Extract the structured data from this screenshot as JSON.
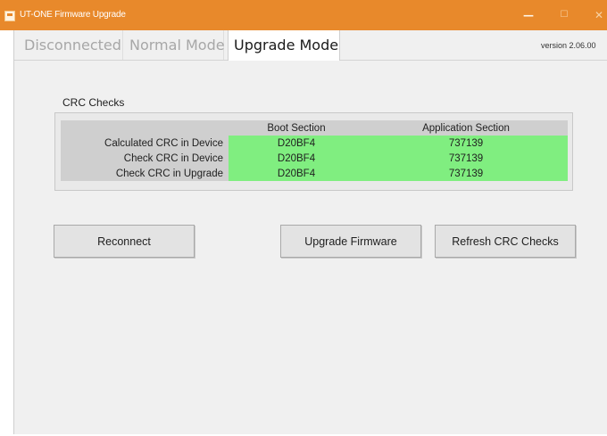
{
  "window": {
    "title": "UT-ONE Firmware Upgrade",
    "controls": {
      "minimize": "—",
      "maximize": "☐",
      "close": "✕"
    },
    "accent_color": "#e8892b"
  },
  "tabs": {
    "items": [
      "Disconnected",
      "Normal Mode",
      "Upgrade Mode"
    ],
    "selected": "Upgrade Mode"
  },
  "version": "version 2.06.00",
  "crc": {
    "label": "CRC Checks",
    "columns": [
      "",
      "Boot Section",
      "Application Section"
    ],
    "rows": [
      {
        "label": "Calculated CRC in Device",
        "boot": "D20BF4",
        "app": "737139"
      },
      {
        "label": "Check CRC in Device",
        "boot": "D20BF4",
        "app": "737139"
      },
      {
        "label": "Check CRC in Upgrade",
        "boot": "D20BF4",
        "app": "737139"
      }
    ],
    "match_color": "#80ee80"
  },
  "buttons": {
    "reconnect": "Reconnect",
    "upgrade": "Upgrade Firmware",
    "refresh": "Refresh CRC Checks"
  }
}
